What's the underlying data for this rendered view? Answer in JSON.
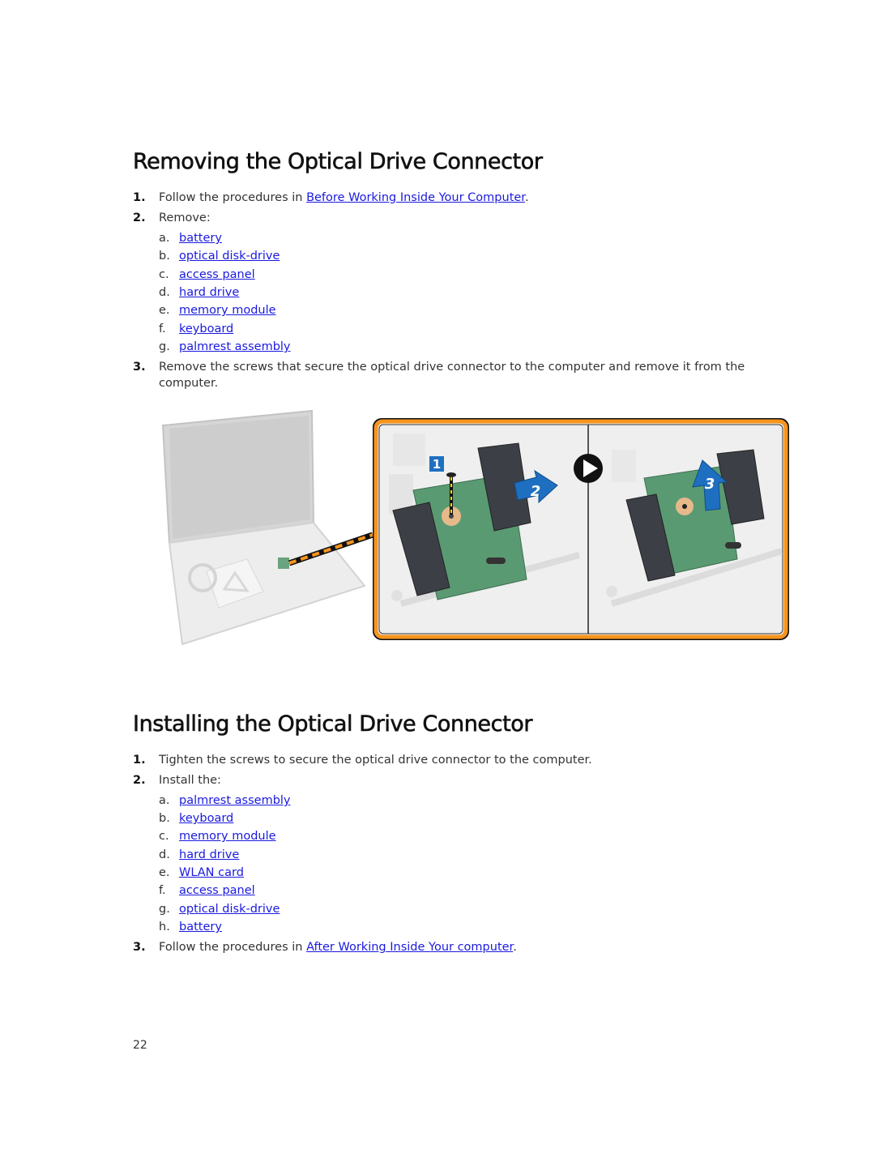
{
  "section1": {
    "title": "Removing the Optical Drive Connector",
    "steps": [
      {
        "num": "1.",
        "pre": "Follow the procedures in ",
        "link": "Before Working Inside Your Computer",
        "post": "."
      },
      {
        "num": "2.",
        "text": "Remove:"
      },
      {
        "num": "3.",
        "text": "Remove the screws that secure the optical drive connector to the computer and remove it from the computer."
      }
    ],
    "remove_items": [
      {
        "letter": "a.",
        "label": "battery"
      },
      {
        "letter": "b.",
        "label": "optical disk-drive"
      },
      {
        "letter": "c.",
        "label": "access panel"
      },
      {
        "letter": "d.",
        "label": "hard drive"
      },
      {
        "letter": "e.",
        "label": "memory module"
      },
      {
        "letter": "f.",
        "label": "keyboard"
      },
      {
        "letter": "g.",
        "label": "palmrest assembly"
      }
    ],
    "figure": {
      "callouts": [
        "1",
        "2",
        "3"
      ],
      "colors": {
        "frame": "#f7941d",
        "callout": "#1f6fc1",
        "board": "#5a9a72",
        "connector": "#3c4046"
      }
    }
  },
  "section2": {
    "title": "Installing the Optical Drive Connector",
    "steps": [
      {
        "num": "1.",
        "text": "Tighten the screws to secure the optical drive connector to the computer."
      },
      {
        "num": "2.",
        "text": "Install the:"
      },
      {
        "num": "3.",
        "pre": "Follow the procedures in ",
        "link": "After Working Inside Your computer",
        "post": "."
      }
    ],
    "install_items": [
      {
        "letter": "a.",
        "label": "palmrest assembly"
      },
      {
        "letter": "b.",
        "label": "keyboard"
      },
      {
        "letter": "c.",
        "label": "memory module"
      },
      {
        "letter": "d.",
        "label": "hard drive"
      },
      {
        "letter": "e.",
        "label": "WLAN card"
      },
      {
        "letter": "f.",
        "label": "access panel"
      },
      {
        "letter": "g.",
        "label": "optical disk-drive"
      },
      {
        "letter": "h.",
        "label": "battery"
      }
    ]
  },
  "footer": {
    "page_number": "22"
  }
}
